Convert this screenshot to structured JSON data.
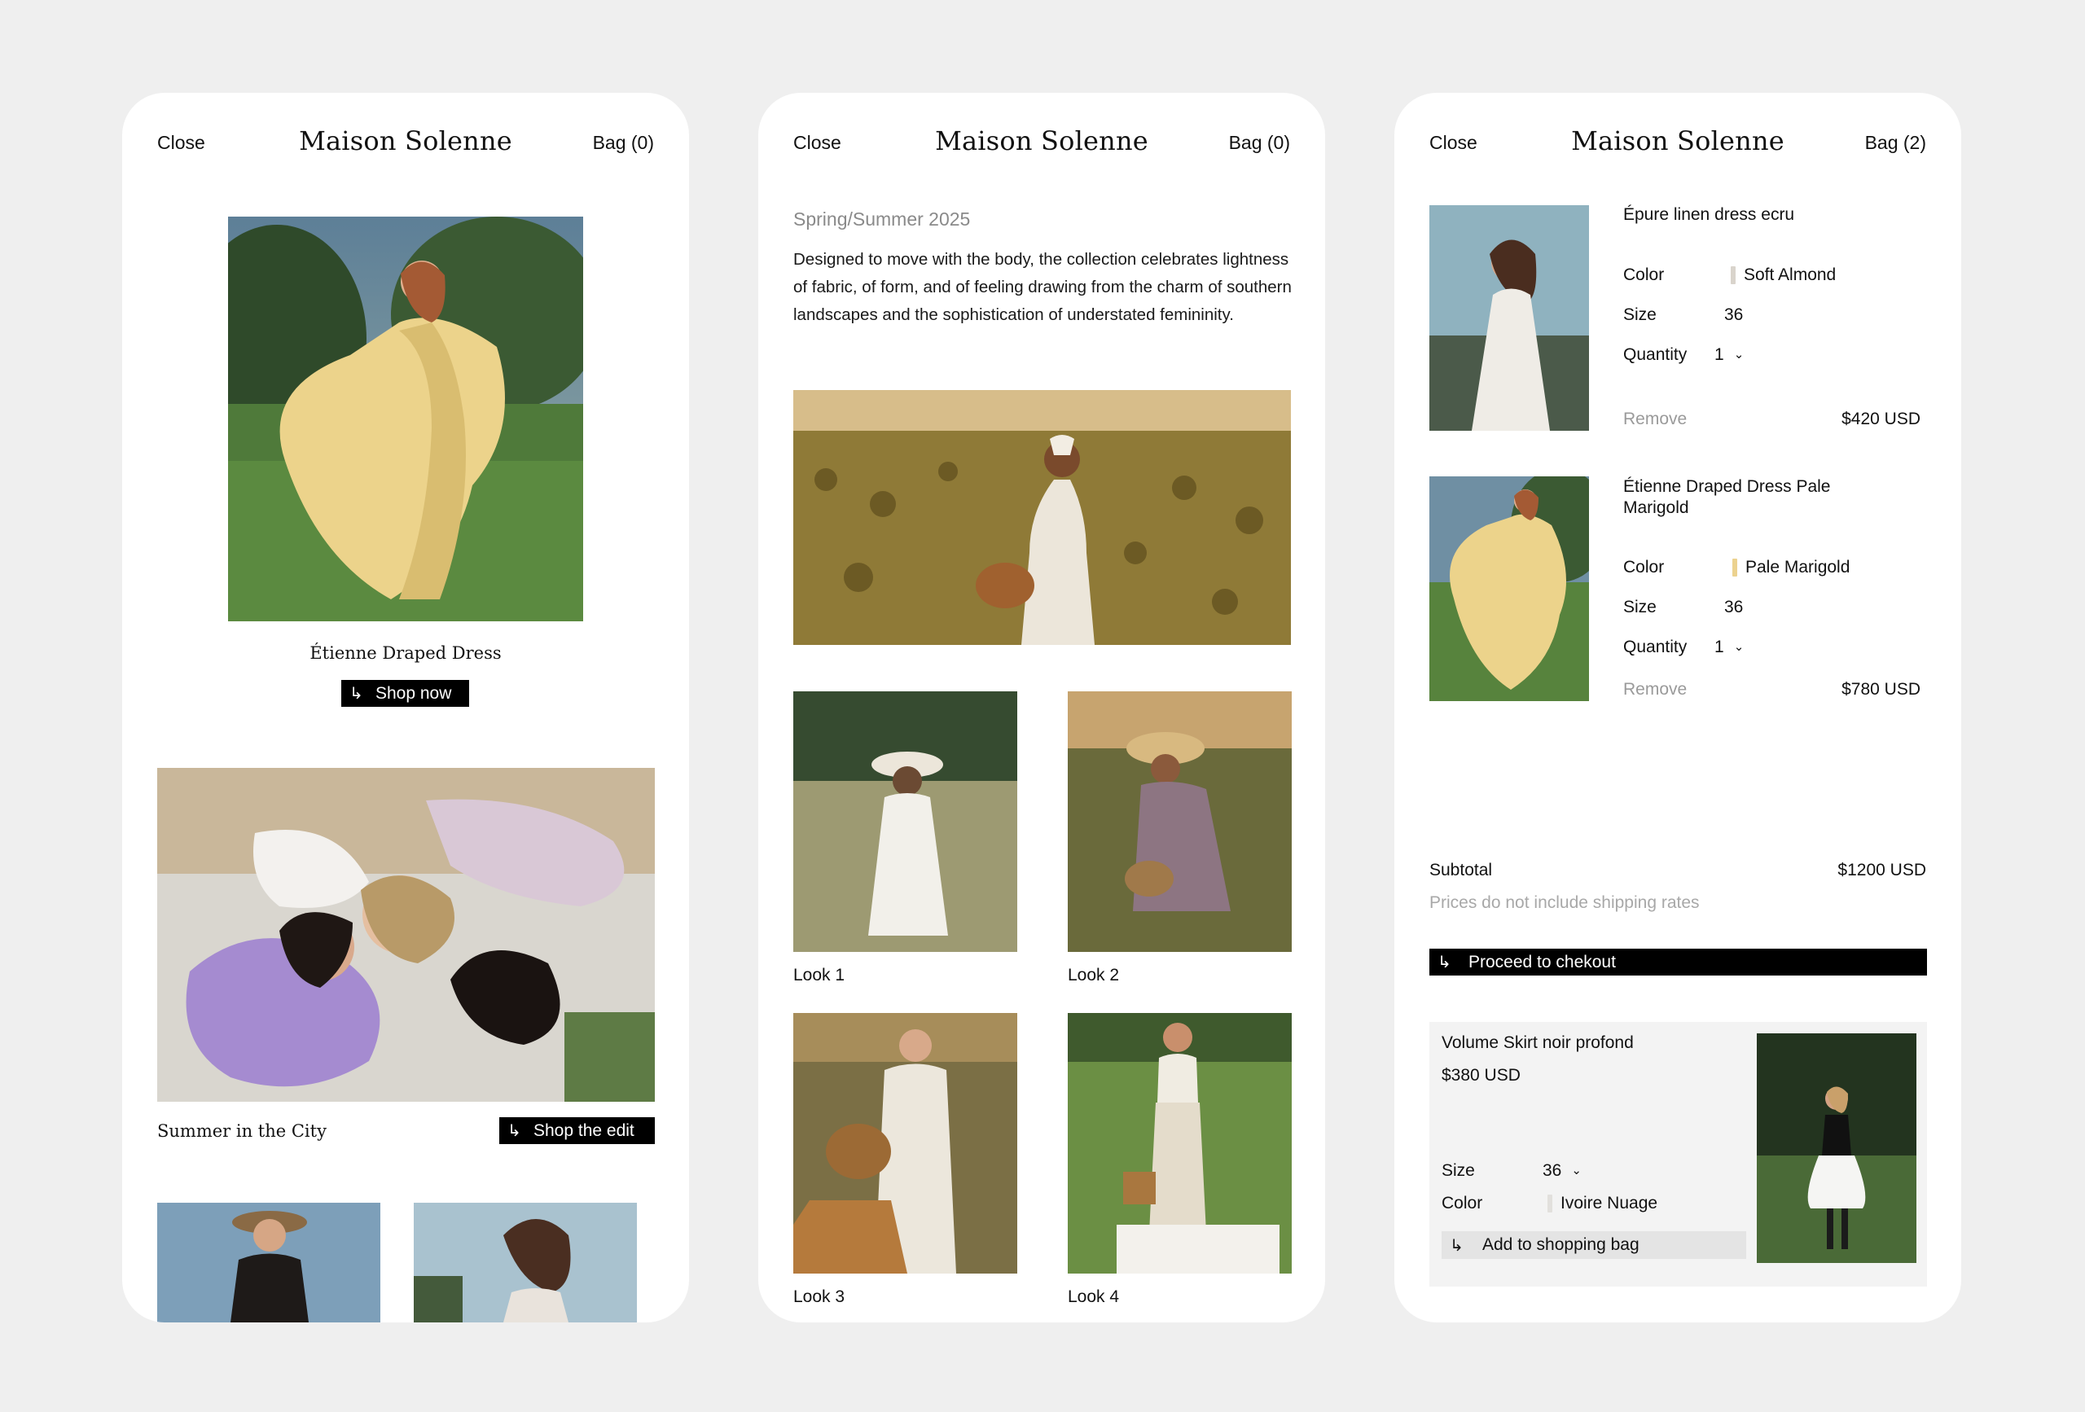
{
  "brand": "Maison Solenne",
  "header": {
    "close_label": "Close"
  },
  "screen1": {
    "bag_label": "Bag (0)",
    "hero_caption": "Étienne Draped Dress",
    "shop_now_label": "Shop now",
    "edit_caption": "Summer in the City",
    "shop_edit_label": "Shop the edit"
  },
  "screen2": {
    "bag_label": "Bag (0)",
    "season": "Spring/Summer 2025",
    "description": "Designed to move with the body, the collection celebrates lightness of fabric, of form, and of feeling drawing from the charm of southern landscapes and the sophistication of understated femininity.",
    "looks": [
      "Look 1",
      "Look 2",
      "Look 3",
      "Look 4"
    ]
  },
  "screen3": {
    "bag_label": "Bag (2)",
    "field_labels": {
      "color": "Color",
      "size": "Size",
      "quantity": "Quantity"
    },
    "remove_label": "Remove",
    "items": [
      {
        "name": "Épure linen dress ecru",
        "color": "Soft Almond",
        "color_hex": "#d9d4cc",
        "size": "36",
        "quantity": "1",
        "price": "$420 USD"
      },
      {
        "name": "Étienne Draped Dress Pale Marigold",
        "color": "Pale Marigold",
        "color_hex": "#ecd28f",
        "size": "36",
        "quantity": "1",
        "price": "$780 USD"
      }
    ],
    "subtotal_label": "Subtotal",
    "subtotal_value": "$1200 USD",
    "shipping_note": "Prices do not include shipping rates",
    "checkout_label": "Proceed to chekout",
    "suggestion": {
      "name": "Volume Skirt noir profond",
      "price": "$380 USD",
      "size_label": "Size",
      "size": "36",
      "color_label": "Color",
      "color": "Ivoire Nuage",
      "color_hex": "#e4e2de",
      "add_label": "Add to shopping bag"
    }
  },
  "colors": {
    "page_bg": "#efefef",
    "card_bg": "#ffffff",
    "button_bg": "#000000",
    "muted_text": "#9a9a9a"
  }
}
